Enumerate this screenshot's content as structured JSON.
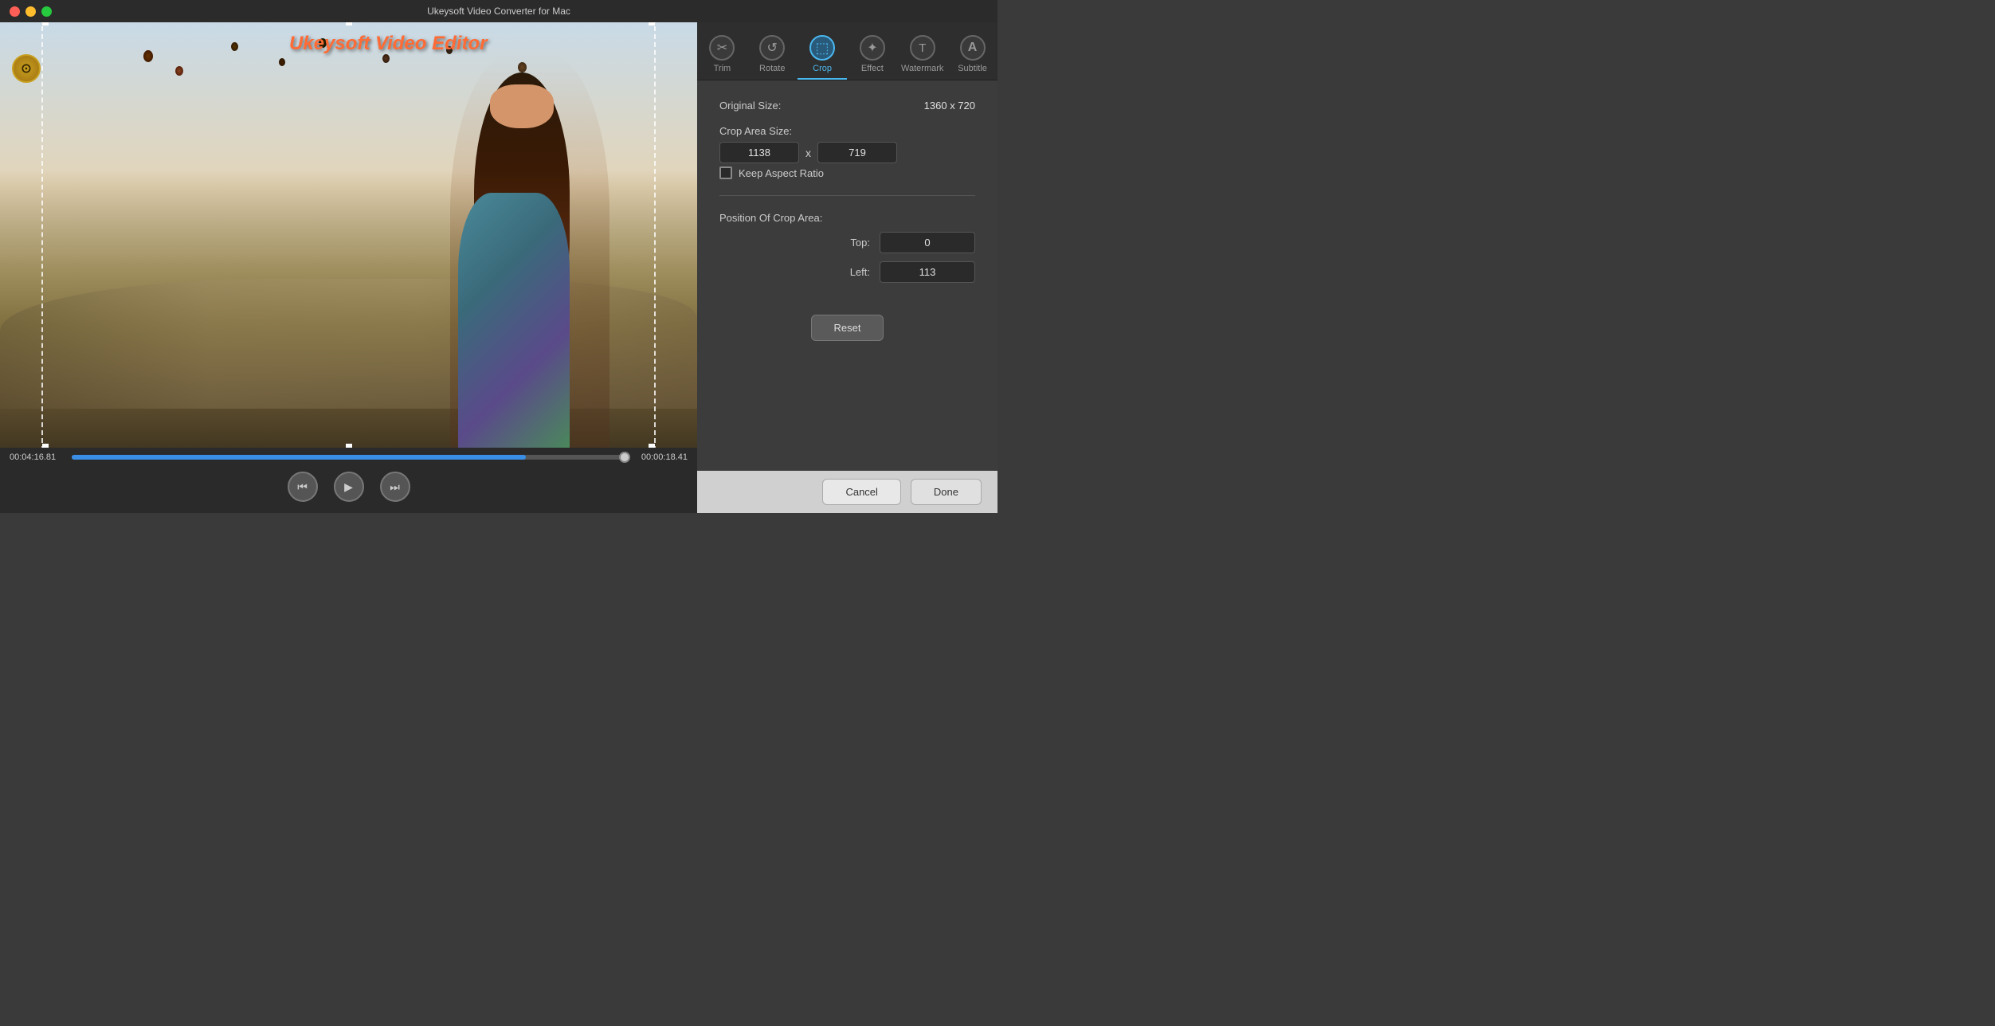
{
  "app": {
    "title": "Ukeysoft Video Converter for Mac",
    "logo": "⊙"
  },
  "titlebar": {
    "close": "close",
    "minimize": "minimize",
    "maximize": "maximize"
  },
  "video": {
    "overlay_text": "Ukeysoft Video Editor",
    "current_time": "00:04:16.81",
    "remaining_time": "00:00:18.41",
    "progress_percent": 82
  },
  "tabs": [
    {
      "id": "trim",
      "label": "Trim",
      "icon": "✂",
      "active": false
    },
    {
      "id": "rotate",
      "label": "Rotate",
      "icon": "↺",
      "active": false
    },
    {
      "id": "crop",
      "label": "Crop",
      "icon": "⬚",
      "active": true
    },
    {
      "id": "effect",
      "label": "Effect",
      "icon": "✦",
      "active": false
    },
    {
      "id": "watermark",
      "label": "Watermark",
      "icon": "T",
      "active": false
    },
    {
      "id": "subtitle",
      "label": "Subtitle",
      "icon": "A",
      "active": false
    }
  ],
  "crop": {
    "original_size_label": "Original Size:",
    "original_size_value": "1360 x 720",
    "crop_area_label": "Crop Area Size:",
    "width": "1138",
    "height": "719",
    "x_separator": "x",
    "keep_aspect_ratio_label": "Keep Aspect Ratio",
    "position_title": "Position Of Crop Area:",
    "top_label": "Top:",
    "top_value": "0",
    "left_label": "Left:",
    "left_value": "113",
    "reset_label": "Reset"
  },
  "actions": {
    "cancel_label": "Cancel",
    "done_label": "Done"
  },
  "controls": {
    "prev_label": "⏮",
    "play_label": "▶",
    "next_label": "⏭"
  }
}
